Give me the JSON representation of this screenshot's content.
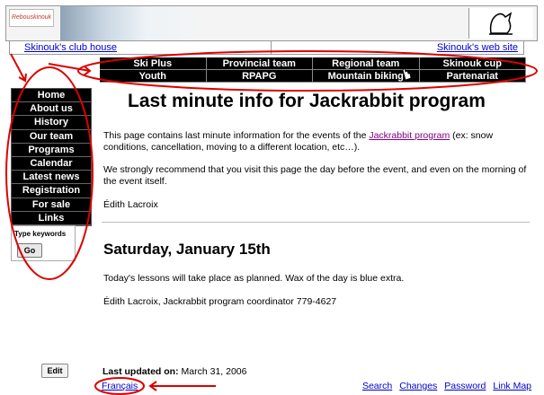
{
  "banner": {
    "logo_text": "Rebouskinouk",
    "logo_icon": "club-logo",
    "owl_icon": "owl-outline-icon"
  },
  "linkbar": {
    "club_house": "Skinouk's club house",
    "web_site": "Skinouk's web site"
  },
  "top_nav": [
    {
      "label": "Ski Plus"
    },
    {
      "label": "Provincial team"
    },
    {
      "label": "Regional team"
    },
    {
      "label": "Skinouk cup"
    },
    {
      "label": "Youth"
    },
    {
      "label": "RPAPG"
    },
    {
      "label": "Mountain biking"
    },
    {
      "label": "Partenariat"
    }
  ],
  "side_nav": [
    {
      "label": "Home"
    },
    {
      "label": "About us"
    },
    {
      "label": "History"
    },
    {
      "label": "Our team"
    },
    {
      "label": "Programs"
    },
    {
      "label": "Calendar"
    },
    {
      "label": "Latest news"
    },
    {
      "label": "Registration"
    },
    {
      "label": "For sale"
    },
    {
      "label": "Links"
    }
  ],
  "search": {
    "label": "Type keywords",
    "button": "Go"
  },
  "content": {
    "title": "Last minute info for Jackrabbit program",
    "p1_before": "This page contains last minute information for the events of the ",
    "p1_link": "Jackrabbit program",
    "p1_after": " (ex: snow conditions, cancellation, moving to a different location, etc…).",
    "p2": "We strongly recommend that you visit this page the day before the event, and even on the morning of the event itself.",
    "p3": "Édith Lacroix",
    "subhead": "Saturday, January 15th",
    "p4": "Today's lessons will take place as planned. Wax of the day is blue extra.",
    "p5": "Édith Lacroix, Jackrabbit program coordinator 779-4627"
  },
  "footer": {
    "edit": "Edit",
    "updated_label": "Last updated on:",
    "updated_value": "March 31, 2006",
    "language": "Français",
    "links": [
      "Search",
      "Changes",
      "Password",
      "Link Map"
    ]
  },
  "annotation_color": "#dd0000"
}
